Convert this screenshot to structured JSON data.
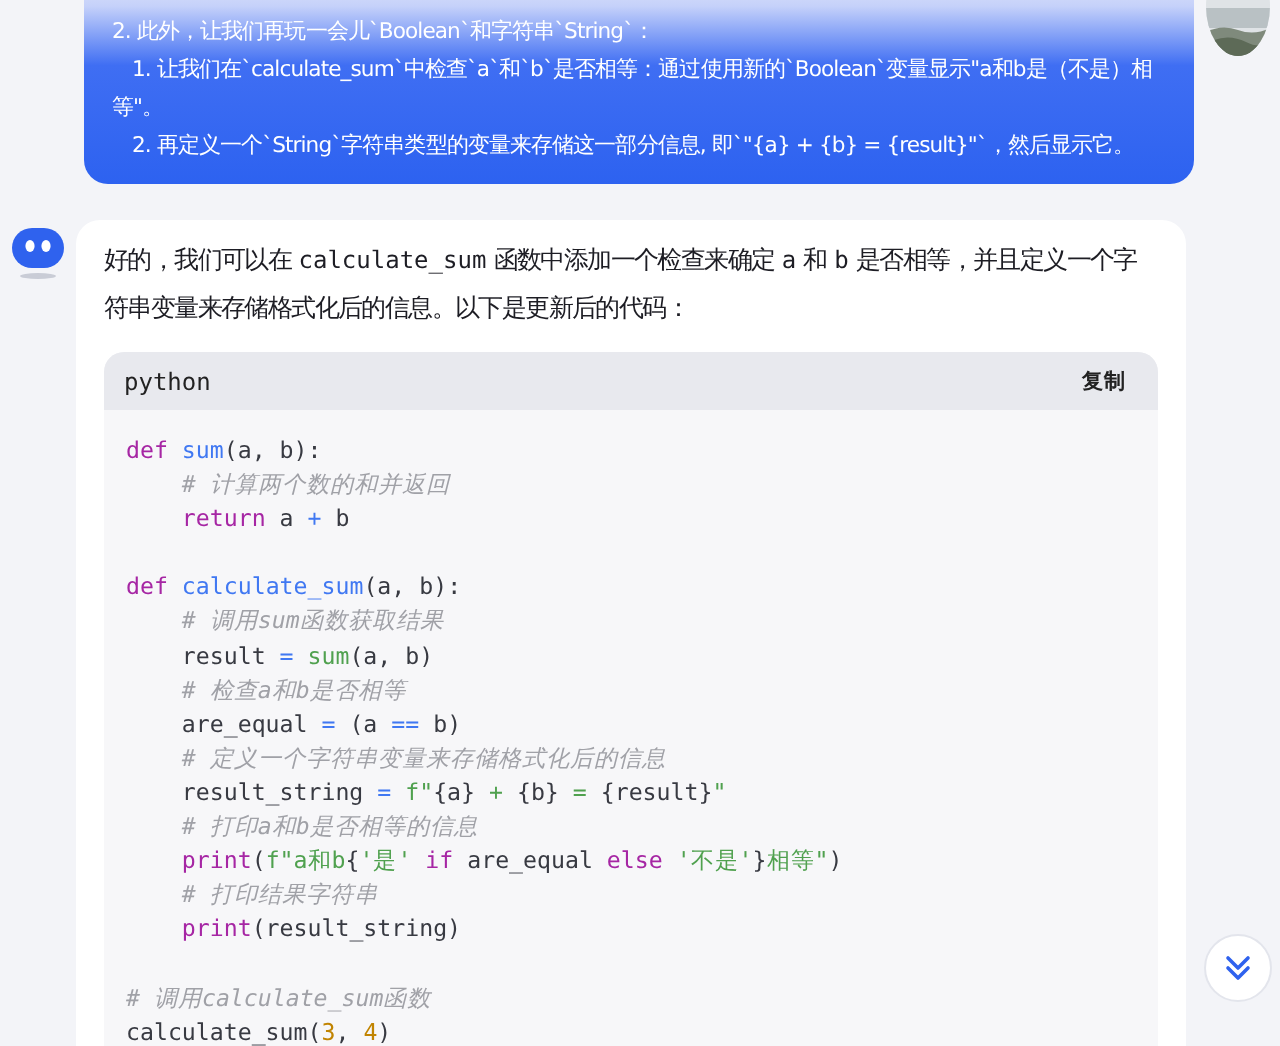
{
  "user_message": {
    "items": [
      {
        "text": "2. 此外，让我们再玩一会儿`Boolean`和字符串`String`：",
        "children": [
          {
            "text": "1. 让我们在`calculate_sum`中检查`a`和`b`是否相等：通过使用新的`Boolean`变量显示\"a和b是（不是）相等\"。"
          },
          {
            "text": "2. 再定义一个`String`字符串类型的变量来存储这一部分信息, 即`\"{a} + {b} = {result}\"`，然后显示它。"
          }
        ]
      }
    ]
  },
  "bot_message": {
    "intro": [
      {
        "kind": "text",
        "t": "好的，我们可以在 "
      },
      {
        "kind": "code",
        "t": "calculate_sum"
      },
      {
        "kind": "text",
        "t": " 函数中添加一个检查来确定 "
      },
      {
        "kind": "code",
        "t": "a"
      },
      {
        "kind": "text",
        "t": " 和 "
      },
      {
        "kind": "code",
        "t": "b"
      },
      {
        "kind": "text",
        "t": " 是否相等，并且定义一个字符串变量来存储格式化后的信息。以下是更新后的代码："
      }
    ],
    "code_block": {
      "language": "python",
      "copy_button": "复制",
      "lines": [
        {
          "kind": "code",
          "tokens": [
            {
              "kind": "kw",
              "t": "def"
            },
            {
              "kind": "fn",
              "t": " sum"
            },
            {
              "kind": "plain",
              "t": "(a, b):"
            }
          ]
        },
        {
          "kind": "code",
          "tokens": [
            {
              "kind": "cmt",
              "t": "    # 计算两个数的和并返回"
            }
          ]
        },
        {
          "kind": "code",
          "tokens": [
            {
              "kind": "kw",
              "t": "    return"
            },
            {
              "kind": "plain",
              "t": " a "
            },
            {
              "kind": "op",
              "t": "+"
            },
            {
              "kind": "plain",
              "t": " b"
            }
          ]
        },
        {
          "kind": "blank"
        },
        {
          "kind": "code",
          "tokens": [
            {
              "kind": "kw",
              "t": "def"
            },
            {
              "kind": "fn",
              "t": " calculate_sum"
            },
            {
              "kind": "plain",
              "t": "(a, b):"
            }
          ]
        },
        {
          "kind": "code",
          "tokens": [
            {
              "kind": "cmt",
              "t": "    # 调用sum函数获取结果"
            }
          ]
        },
        {
          "kind": "code",
          "tokens": [
            {
              "kind": "plain",
              "t": "    result "
            },
            {
              "kind": "op",
              "t": "="
            },
            {
              "kind": "builtin",
              "t": " sum"
            },
            {
              "kind": "plain",
              "t": "(a, b)"
            }
          ]
        },
        {
          "kind": "code",
          "tokens": [
            {
              "kind": "cmt",
              "t": "    # 检查a和b是否相等"
            }
          ]
        },
        {
          "kind": "code",
          "tokens": [
            {
              "kind": "plain",
              "t": "    are_equal "
            },
            {
              "kind": "op",
              "t": "="
            },
            {
              "kind": "plain",
              "t": " (a "
            },
            {
              "kind": "op",
              "t": "=="
            },
            {
              "kind": "plain",
              "t": " b)"
            }
          ]
        },
        {
          "kind": "code",
          "tokens": [
            {
              "kind": "cmt",
              "t": "    # 定义一个字符串变量来存储格式化后的信息"
            }
          ]
        },
        {
          "kind": "code",
          "tokens": [
            {
              "kind": "plain",
              "t": "    result_string "
            },
            {
              "kind": "op",
              "t": "="
            },
            {
              "kind": "str",
              "t": " f\""
            },
            {
              "kind": "plain",
              "t": "{a} "
            },
            {
              "kind": "str",
              "t": "+"
            },
            {
              "kind": "plain",
              "t": " {b} "
            },
            {
              "kind": "str",
              "t": "="
            },
            {
              "kind": "plain",
              "t": " {result}"
            },
            {
              "kind": "str",
              "t": "\""
            }
          ]
        },
        {
          "kind": "code",
          "tokens": [
            {
              "kind": "cmt",
              "t": "    # 打印a和b是否相等的信息"
            }
          ]
        },
        {
          "kind": "code",
          "tokens": [
            {
              "kind": "kw",
              "t": "    print"
            },
            {
              "kind": "plain",
              "t": "("
            },
            {
              "kind": "str",
              "t": "f\"a和b"
            },
            {
              "kind": "plain",
              "t": "{"
            },
            {
              "kind": "str",
              "t": "'是'"
            },
            {
              "kind": "kw",
              "t": " if"
            },
            {
              "kind": "plain",
              "t": " are_equal "
            },
            {
              "kind": "kw",
              "t": "else"
            },
            {
              "kind": "str",
              "t": " '不是'"
            },
            {
              "kind": "plain",
              "t": "}"
            },
            {
              "kind": "str",
              "t": "相等\""
            },
            {
              "kind": "plain",
              "t": ")"
            }
          ]
        },
        {
          "kind": "code",
          "tokens": [
            {
              "kind": "cmt",
              "t": "    # 打印结果字符串"
            }
          ]
        },
        {
          "kind": "code",
          "tokens": [
            {
              "kind": "kw",
              "t": "    print"
            },
            {
              "kind": "plain",
              "t": "(result_string)"
            }
          ]
        },
        {
          "kind": "blank"
        },
        {
          "kind": "code",
          "tokens": [
            {
              "kind": "cmt",
              "t": "# 调用calculate_sum函数"
            }
          ]
        },
        {
          "kind": "code",
          "tokens": [
            {
              "kind": "plain",
              "t": "calculate_sum("
            },
            {
              "kind": "num",
              "t": "3"
            },
            {
              "kind": "plain",
              "t": ", "
            },
            {
              "kind": "num",
              "t": "4"
            },
            {
              "kind": "plain",
              "t": ")"
            }
          ]
        }
      ]
    }
  }
}
